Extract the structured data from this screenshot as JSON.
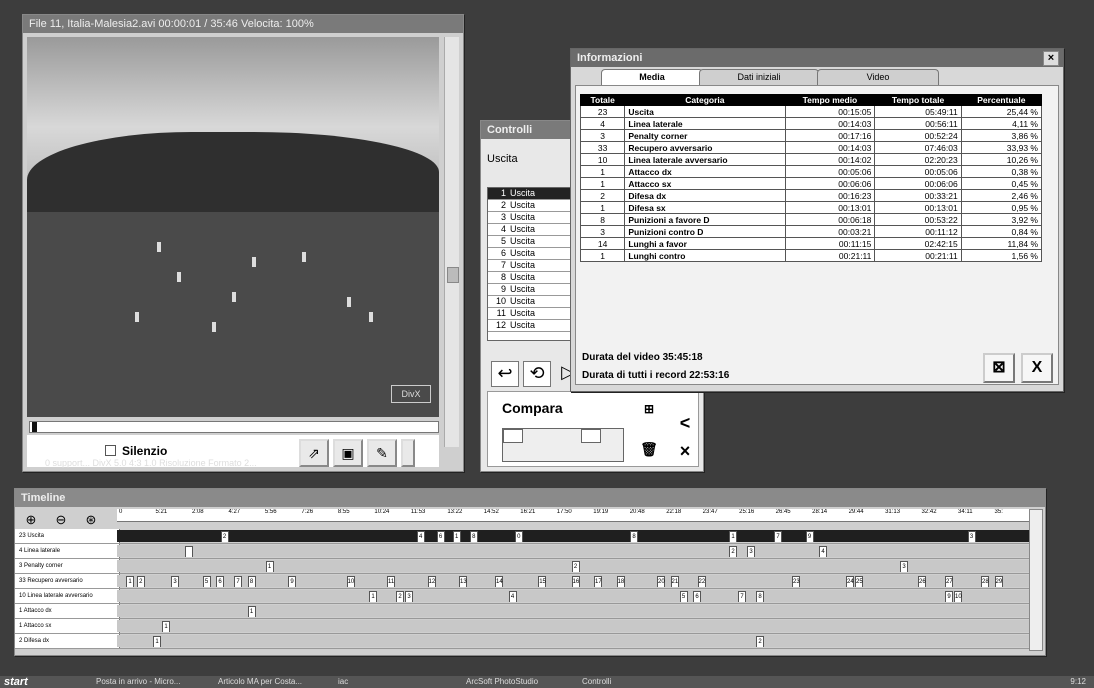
{
  "video": {
    "title": "File 11, Italia-Malesia2.avi      00:00:01 / 35:46      Velocita:  100%",
    "silenzio_label": "Silenzio",
    "status": "0 support...    DivX 5.0    4:3 1.0    Risoluzione    Formato 2..."
  },
  "controlli": {
    "title": "Controlli",
    "category_label": "Uscita",
    "rows": [
      {
        "n": "1",
        "label": "Uscita"
      },
      {
        "n": "2",
        "label": "Uscita"
      },
      {
        "n": "3",
        "label": "Uscita"
      },
      {
        "n": "4",
        "label": "Uscita"
      },
      {
        "n": "5",
        "label": "Uscita"
      },
      {
        "n": "6",
        "label": "Uscita"
      },
      {
        "n": "7",
        "label": "Uscita"
      },
      {
        "n": "8",
        "label": "Uscita"
      },
      {
        "n": "9",
        "label": "Uscita"
      },
      {
        "n": "10",
        "label": "Uscita"
      },
      {
        "n": "11",
        "label": "Uscita"
      },
      {
        "n": "12",
        "label": "Uscita"
      }
    ],
    "compara_label": "Compara"
  },
  "info": {
    "title": "Informazioni",
    "tabs": [
      "Media",
      "Dati iniziali",
      "Video"
    ],
    "columns": [
      "Totale",
      "Categoria",
      "Tempo medio",
      "Tempo totale",
      "Percentuale"
    ],
    "rows": [
      [
        "23",
        "Uscita",
        "00:15:05",
        "05:49:11",
        "25,44 %"
      ],
      [
        "4",
        "Linea laterale",
        "00:14:03",
        "00:56:11",
        "4,11 %"
      ],
      [
        "3",
        "Penalty corner",
        "00:17:16",
        "00:52:24",
        "3,86 %"
      ],
      [
        "33",
        "Recupero avversario",
        "00:14:03",
        "07:46:03",
        "33,93 %"
      ],
      [
        "10",
        "Linea laterale avversario",
        "00:14:02",
        "02:20:23",
        "10,26 %"
      ],
      [
        "1",
        "Attacco dx",
        "00:05:06",
        "00:05:06",
        "0,38 %"
      ],
      [
        "1",
        "Attacco sx",
        "00:06:06",
        "00:06:06",
        "0,45 %"
      ],
      [
        "2",
        "Difesa dx",
        "00:16:23",
        "00:33:21",
        "2,46 %"
      ],
      [
        "1",
        "Difesa sx",
        "00:13:01",
        "00:13:01",
        "0,95 %"
      ],
      [
        "8",
        "Punizioni a favore D",
        "00:06:18",
        "00:53:22",
        "3,92 %"
      ],
      [
        "3",
        "Punizioni contro D",
        "00:03:21",
        "00:11:12",
        "0,84 %"
      ],
      [
        "14",
        "Lunghi a favor",
        "00:11:15",
        "02:42:15",
        "11,84 %"
      ],
      [
        "1",
        "Lunghi contro",
        "00:21:11",
        "00:21:11",
        "1,56 %"
      ]
    ],
    "durata_video": "Durata del video  35:45:18",
    "durata_record": "Durata di tutti i record  22:53:16"
  },
  "timeline": {
    "title": "Timeline",
    "ticks": [
      "0",
      "5:21",
      "2:08",
      "4:27",
      "5:56",
      "7:26",
      "8:55",
      "10:24",
      "11:53",
      "13:22",
      "14:52",
      "16:21",
      "17:50",
      "19:19",
      "20:48",
      "22:18",
      "23:47",
      "25:16",
      "26:45",
      "28:14",
      "29:44",
      "31:13",
      "32:42",
      "34:11",
      "35:"
    ],
    "rows": [
      {
        "label": "23 Uscita",
        "dark": true,
        "marks": [
          [
            "2",
            0.115
          ],
          [
            "4",
            0.333
          ],
          [
            "6",
            0.355
          ],
          [
            "1",
            0.373
          ],
          [
            "8",
            0.392
          ],
          [
            "0",
            0.442
          ],
          [
            "8",
            0.57
          ],
          [
            "1",
            0.68
          ],
          [
            "7",
            0.73
          ],
          [
            "9",
            0.765
          ],
          [
            "3",
            0.945
          ]
        ]
      },
      {
        "label": "4 Linea laterale",
        "dark": false,
        "marks": [
          [
            "",
            0.075
          ],
          [
            "2",
            0.68
          ],
          [
            "3",
            0.7
          ],
          [
            "4",
            0.78
          ]
        ]
      },
      {
        "label": "3 Penalty corner",
        "dark": false,
        "marks": [
          [
            "1",
            0.165
          ],
          [
            "2",
            0.505
          ],
          [
            "3",
            0.87
          ]
        ]
      },
      {
        "label": "33 Recupero avversario",
        "dark": false,
        "marks": [
          [
            "1",
            0.01
          ],
          [
            "2",
            0.022
          ],
          [
            "3",
            0.06
          ],
          [
            "5",
            0.095
          ],
          [
            "6",
            0.11
          ],
          [
            "7",
            0.13
          ],
          [
            "8",
            0.145
          ],
          [
            "9",
            0.19
          ],
          [
            "10",
            0.255
          ],
          [
            "11",
            0.3
          ],
          [
            "12",
            0.345
          ],
          [
            "13",
            0.38
          ],
          [
            "14",
            0.42
          ],
          [
            "15",
            0.468
          ],
          [
            "16",
            0.505
          ],
          [
            "17",
            0.53
          ],
          [
            "18",
            0.555
          ],
          [
            "20",
            0.6
          ],
          [
            "21",
            0.615
          ],
          [
            "22",
            0.645
          ],
          [
            "23",
            0.75
          ],
          [
            "24",
            0.81
          ],
          [
            "25",
            0.82
          ],
          [
            "26",
            0.89
          ],
          [
            "27",
            0.92
          ],
          [
            "28",
            0.96
          ],
          [
            "29",
            0.975
          ]
        ]
      },
      {
        "label": "10 Linea laterale avversario",
        "dark": false,
        "marks": [
          [
            "1",
            0.28
          ],
          [
            "2",
            0.31
          ],
          [
            "3",
            0.32
          ],
          [
            "4",
            0.435
          ],
          [
            "5",
            0.625
          ],
          [
            "6",
            0.64
          ],
          [
            "7",
            0.69
          ],
          [
            "8",
            0.71
          ],
          [
            "9",
            0.92
          ],
          [
            "10",
            0.93
          ]
        ]
      },
      {
        "label": "1 Attacco dx",
        "dark": false,
        "marks": [
          [
            "1",
            0.145
          ]
        ]
      },
      {
        "label": "1 Attacco sx",
        "dark": false,
        "marks": [
          [
            "1",
            0.05
          ]
        ]
      },
      {
        "label": "2 Difesa dx",
        "dark": false,
        "marks": [
          [
            "1",
            0.04
          ],
          [
            "2",
            0.71
          ]
        ]
      }
    ]
  },
  "taskbar": {
    "start": "start",
    "items": [
      "Posta in arrivo - Micro...",
      "Articolo MA per Costa...",
      "iac",
      "ArcSoft PhotoStudio",
      "Controlli"
    ],
    "clock": "9:12"
  }
}
